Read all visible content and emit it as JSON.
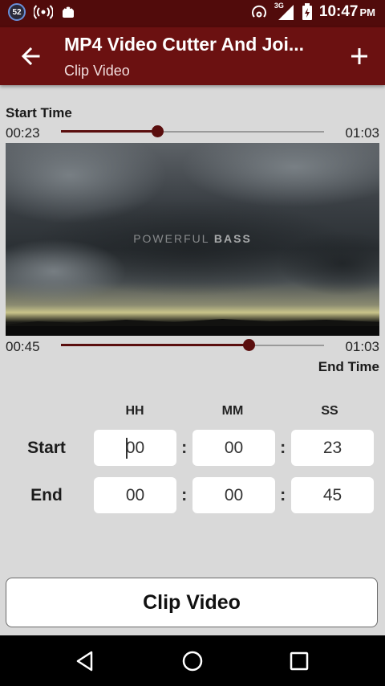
{
  "status_bar": {
    "notification_count": "52",
    "network_type": "3G",
    "time": "10:47",
    "ampm": "PM"
  },
  "app_bar": {
    "title": "MP4 Video Cutter And Joi...",
    "subtitle": "Clip Video",
    "back_icon": "arrow-left",
    "add_icon": "plus"
  },
  "start_seek": {
    "label": "Start Time",
    "current": "00:23",
    "total": "01:03",
    "fraction": 0.365
  },
  "video": {
    "watermark_light": "POWERFUL ",
    "watermark_bold": "BASS"
  },
  "end_seek": {
    "label": "End Time",
    "current": "00:45",
    "total": "01:03",
    "fraction": 0.714
  },
  "time_table": {
    "headers": [
      "HH",
      "MM",
      "SS"
    ],
    "start_label": "Start",
    "end_label": "End",
    "start": {
      "hh": "00",
      "mm": "00",
      "ss": "23"
    },
    "end": {
      "hh": "00",
      "mm": "00",
      "ss": "45"
    },
    "separator": ":"
  },
  "clip_button": "Clip Video",
  "colors": {
    "app_bar": "#6b1111",
    "status_bar": "#510b0b",
    "accent": "#5a0e0e",
    "background": "#d9d9d9"
  },
  "nav": {
    "back": "triangle-back",
    "home": "circle-home",
    "recents": "square-recents"
  }
}
